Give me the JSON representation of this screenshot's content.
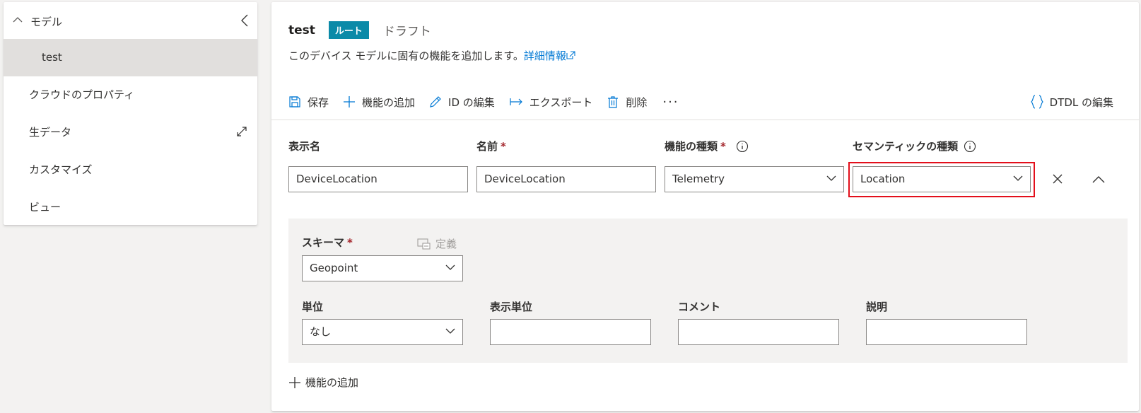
{
  "sidebar": {
    "title": "モデル",
    "items": [
      {
        "label": "test"
      },
      {
        "label": "クラウドのプロパティ"
      },
      {
        "label": "生データ"
      },
      {
        "label": "カスタマイズ"
      },
      {
        "label": "ビュー"
      }
    ]
  },
  "header": {
    "name": "test",
    "badge": "ルート",
    "draft": "ドラフト",
    "description": "このデバイス モデルに固有の機能を追加します。",
    "learn_more": "詳細情報"
  },
  "toolbar": {
    "save": "保存",
    "add_capability": "機能の追加",
    "edit_id": "ID の編集",
    "export": "エクスポート",
    "delete": "削除",
    "more": "···",
    "edit_dtdl": "DTDL の編集"
  },
  "capability": {
    "display_name_label": "表示名",
    "name_label": "名前",
    "type_label": "機能の種類",
    "semantic_label": "セマンティックの種類",
    "required_mark": "*",
    "display_name_value": "DeviceLocation",
    "name_value": "DeviceLocation",
    "type_value": "Telemetry",
    "semantic_value": "Location"
  },
  "details": {
    "schema_label": "スキーマ",
    "define": "定義",
    "schema_value": "Geopoint",
    "unit_label": "単位",
    "unit_value": "なし",
    "display_unit_label": "表示単位",
    "comment_label": "コメント",
    "description_label": "説明",
    "display_unit_value": "",
    "comment_value": "",
    "description_value": ""
  },
  "footer": {
    "add_capability": "機能の追加"
  },
  "colors": {
    "accent": "#0078d4",
    "badge": "#0b8aa8",
    "highlight": "#e30f1b",
    "required": "#a4262c"
  }
}
